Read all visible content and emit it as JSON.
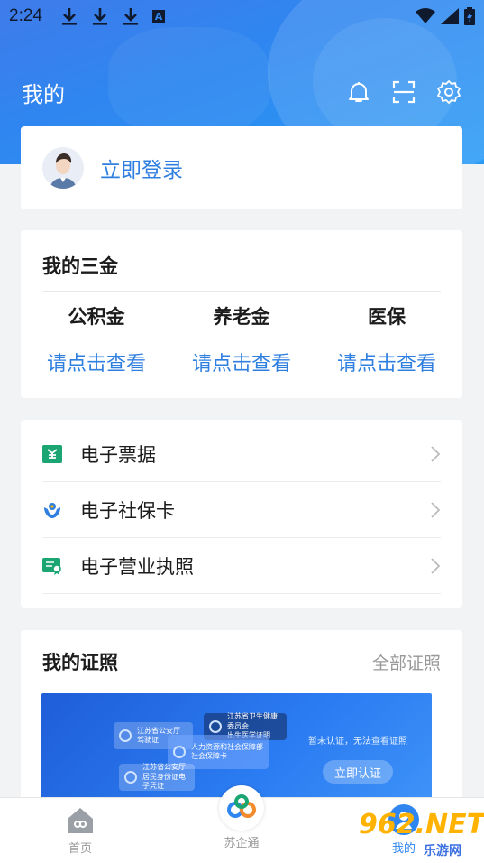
{
  "status_bar": {
    "time": "2:24",
    "left_icons": [
      "download-icon",
      "download-icon",
      "download-icon",
      "a-badge-icon"
    ],
    "right_icons": [
      "wifi-icon",
      "signal-icon",
      "battery-icon"
    ],
    "a_badge": "A"
  },
  "header": {
    "title": "我的",
    "actions": [
      "bell-icon",
      "scan-icon",
      "settings-icon"
    ]
  },
  "login": {
    "label": "立即登录"
  },
  "sanjin": {
    "title": "我的三金",
    "items": [
      {
        "name": "公积金",
        "link": "请点击查看"
      },
      {
        "name": "养老金",
        "link": "请点击查看"
      },
      {
        "name": "医保",
        "link": "请点击查看"
      }
    ]
  },
  "services": {
    "items": [
      {
        "label": "电子票据",
        "icon": "receipt-icon"
      },
      {
        "label": "电子社保卡",
        "icon": "social-security-icon"
      },
      {
        "label": "电子营业执照",
        "icon": "business-license-icon"
      }
    ]
  },
  "certificates": {
    "title": "我的证照",
    "all_label": "全部证照",
    "banner": {
      "tip": "暂未认证，无法查看证照",
      "button": "立即认证",
      "cards": [
        {
          "line1": "江苏省公安厅",
          "line2": "驾驶证"
        },
        {
          "line1": "江苏省卫生健康委员会",
          "line2": "出生医学证明"
        },
        {
          "line1": "人力资源和社会保障部",
          "line2": "社会保障卡"
        },
        {
          "line1": "江苏省公安厅",
          "line2": "居民身份证电子凭证"
        }
      ]
    }
  },
  "bottom_nav": {
    "items": [
      {
        "label": "首页",
        "icon": "home-icon"
      },
      {
        "label": "苏企通",
        "icon": "suqitong-logo-icon"
      },
      {
        "label": "我的",
        "icon": "profile-icon"
      }
    ]
  },
  "watermark": {
    "text": "962.NET",
    "sub": "乐游网"
  },
  "colors": {
    "primary": "#2f86f0",
    "link": "#2f7fe0",
    "accent_green": "#1aa572"
  }
}
